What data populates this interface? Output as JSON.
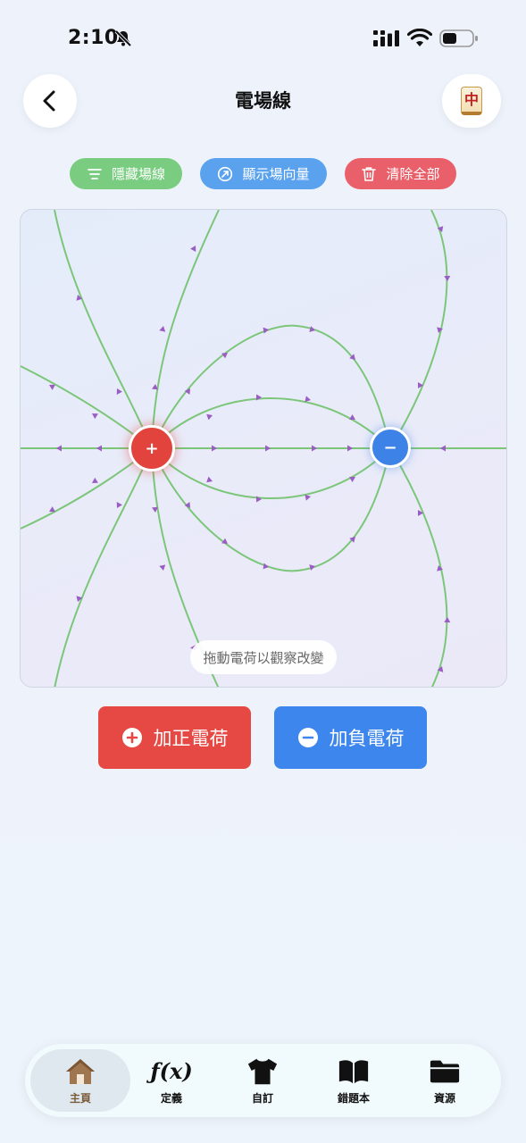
{
  "status_bar": {
    "time": "2:10",
    "icons": [
      "bell-slash-icon",
      "signal-icon",
      "wifi-icon",
      "battery-icon"
    ]
  },
  "header": {
    "title": "電場線",
    "back_icon": "chevron-left-icon",
    "right_button_glyph": "中"
  },
  "actions": {
    "hide_lines": {
      "label": "隱藏場線",
      "icon": "lines-icon",
      "color": "#7acd80"
    },
    "show_vectors": {
      "label": "顯示場向量",
      "icon": "arrow-circle-icon",
      "color": "#5aa2ee"
    },
    "clear_all": {
      "label": "清除全部",
      "icon": "trash-icon",
      "color": "#e9606a"
    }
  },
  "canvas": {
    "hint": "拖動電荷以觀察改變",
    "charges": [
      {
        "sign": "+",
        "type": "positive",
        "color": "#e2433c"
      },
      {
        "sign": "−",
        "type": "negative",
        "color": "#3d82e6"
      }
    ],
    "field_line_color": "#7cc67a",
    "arrow_color": "#9a5dc4"
  },
  "buttons": {
    "add_positive": {
      "label": "加正電荷",
      "color": "#e64944"
    },
    "add_negative": {
      "label": "加負電荷",
      "color": "#3c86ed"
    }
  },
  "nav": {
    "items": [
      {
        "label": "主頁",
        "icon": "home-icon",
        "active": true
      },
      {
        "label": "定義",
        "icon": "function-icon",
        "glyph": "ƒ(x)",
        "active": false
      },
      {
        "label": "自訂",
        "icon": "tshirt-icon",
        "active": false
      },
      {
        "label": "錯題本",
        "icon": "book-icon",
        "active": false
      },
      {
        "label": "資源",
        "icon": "folder-icon",
        "active": false
      }
    ]
  }
}
